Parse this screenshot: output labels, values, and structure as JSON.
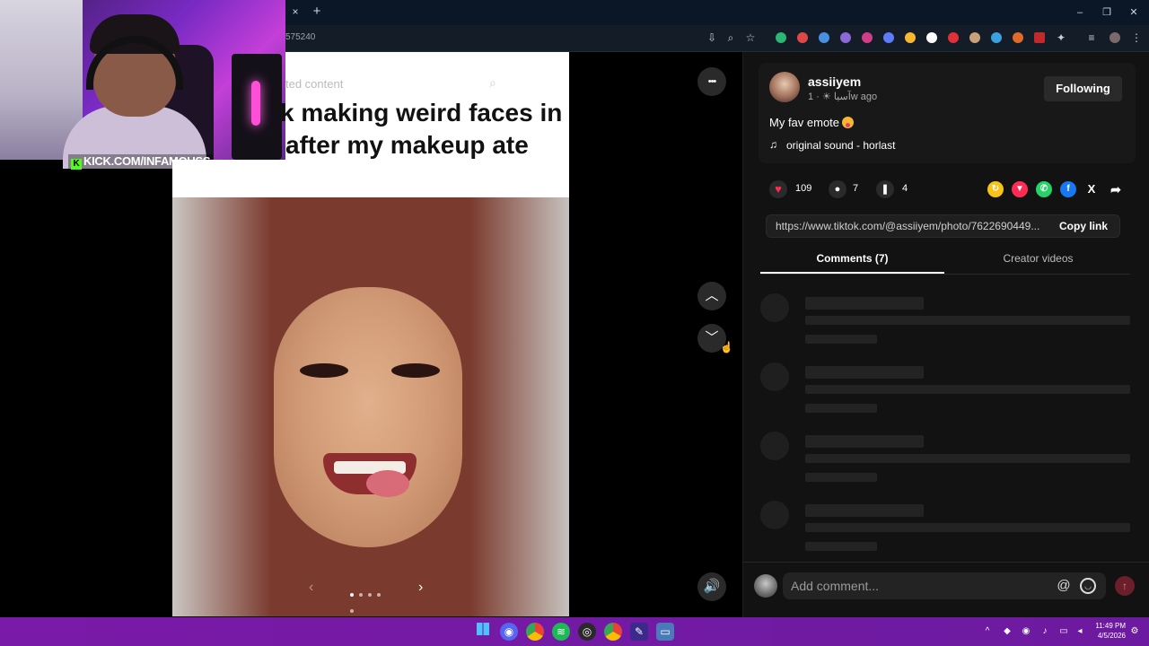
{
  "browser": {
    "url_fragment": "575240",
    "tab_close": "×",
    "new_tab": "+",
    "window_controls": [
      "–",
      "❐",
      "✕"
    ]
  },
  "stream_overlay": {
    "label": "KICK.COM/INFAMOUSS",
    "kick_letter": "K"
  },
  "post": {
    "search_fragment": "ted content",
    "text_line1": "k making weird faces in",
    "text_line2": "after my makeup ate",
    "slide_count": 5,
    "active_slide": 0,
    "prev_arrow": "‹",
    "next_arrow": "›"
  },
  "nav": {
    "more": "•••",
    "up": "︿",
    "down": "﹀",
    "volume": "🔊"
  },
  "author": {
    "username": "assiiyem",
    "display_line": "آسيا ☀ · 1w ago",
    "follow_label": "Following"
  },
  "caption": {
    "text": "My fav emote",
    "sound_icon": "♫",
    "sound": "original sound - horlast"
  },
  "actions": {
    "likes": "109",
    "comments": "7",
    "saves": "4"
  },
  "share": {
    "link": "https://www.tiktok.com/@assiiyem/photo/7622690449...",
    "copy_label": "Copy link",
    "x_label": "X"
  },
  "tabs": {
    "comments": "Comments (7)",
    "creator": "Creator videos"
  },
  "comment_box": {
    "placeholder": "Add comment...",
    "at": "@"
  },
  "system": {
    "time": "11:49 PM",
    "date": "4/5/2026"
  },
  "colors": {
    "like": "#fe2c55",
    "share_yellow": "#f7c31b",
    "share_red": "#fe2c55",
    "whatsapp": "#25d366",
    "facebook": "#1877f2",
    "taskbar": "#7a1aa8"
  }
}
